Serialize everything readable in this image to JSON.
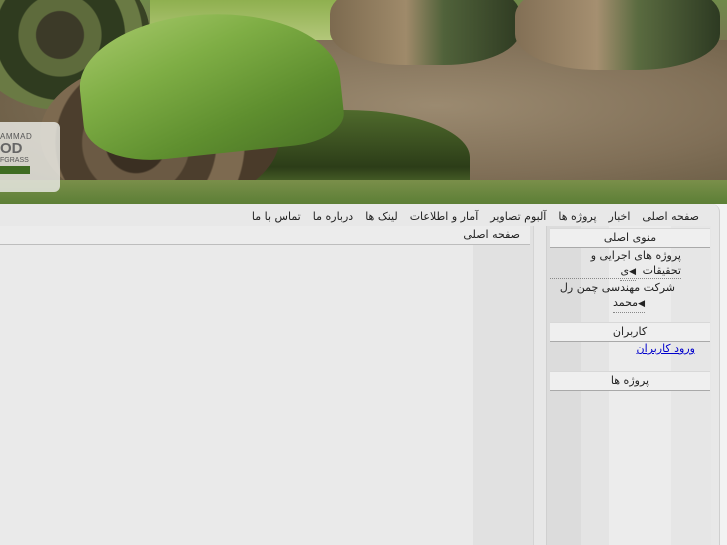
{
  "banner": {
    "logo_line1": "AMMAD",
    "logo_line2": "OD",
    "logo_line3": "FGRASS"
  },
  "topnav": [
    {
      "label": "صفحه اصلی"
    },
    {
      "label": "اخبار"
    },
    {
      "label": "پروژه ها"
    },
    {
      "label": "آلبوم تصاویر"
    },
    {
      "label": "آمار و اطلاعات"
    },
    {
      "label": "لینک ها"
    },
    {
      "label": "درباره ما"
    },
    {
      "label": "تماس با ما"
    }
  ],
  "content": {
    "title": "صفحه اصلی"
  },
  "sidebar": {
    "main_menu": {
      "title": "منوی اصلی",
      "item1_line1": "پروژه های اجرایی و تحقیقات",
      "item1_line2": "ی",
      "item2_line1": "شرکت مهندسی چمن رل",
      "item2_line2": "محمد"
    },
    "users": {
      "title": "کاربران",
      "login_link": "ورود کاربران"
    },
    "projects": {
      "title": "پروژه ها"
    }
  }
}
